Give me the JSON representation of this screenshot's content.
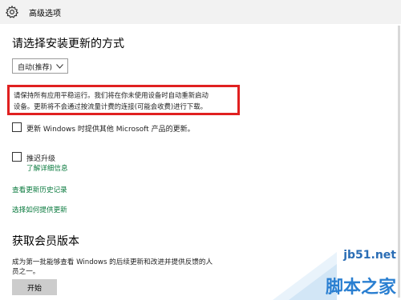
{
  "window": {
    "title": "高级选项"
  },
  "install_section": {
    "heading": "请选择安装更新的方式",
    "dropdown_value": "自动(推荐)",
    "notice_line1": "请保持所有应用平稳运行。我们将在你未使用设备时自动重新启动",
    "notice_line2": "设备。更新将不会通过按流量计费的连接(可能会收费)进行下载。",
    "highlight_color": "#e02020"
  },
  "options": {
    "ms_updates_label": "更新 Windows 时提供其他 Microsoft 产品的更新。",
    "defer_label": "推迟升级",
    "learn_more_link": "了解详细信息",
    "history_link": "查看更新历史记录",
    "delivery_link": "选择如何提供更新",
    "link_color": "#0a7a3e"
  },
  "insider_section": {
    "heading": "获取会员版本",
    "desc_line1": "成为第一批能够查看 Windows 的后续更新和改进并提供反馈的人",
    "desc_line2": "员之一。",
    "start_button": "开始"
  },
  "watermark": {
    "url": "jb51.net",
    "name": "脚本之家"
  }
}
